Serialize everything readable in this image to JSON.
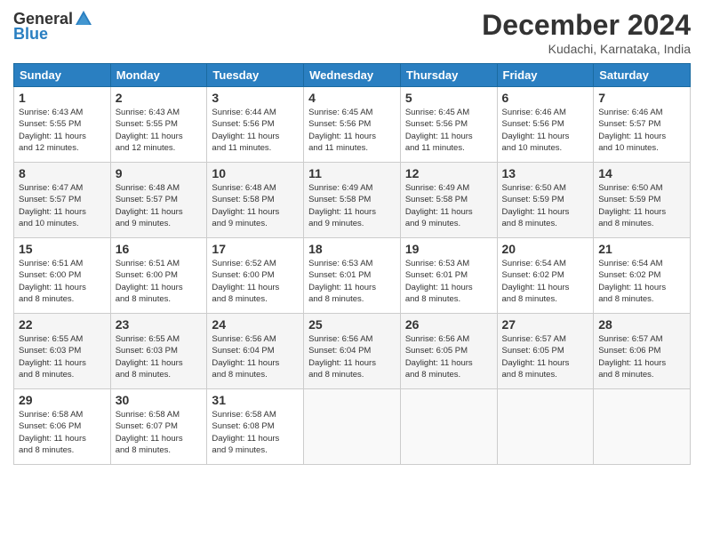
{
  "header": {
    "logo_general": "General",
    "logo_blue": "Blue",
    "title": "December 2024",
    "location": "Kudachi, Karnataka, India"
  },
  "days_of_week": [
    "Sunday",
    "Monday",
    "Tuesday",
    "Wednesday",
    "Thursday",
    "Friday",
    "Saturday"
  ],
  "weeks": [
    [
      {
        "day": "1",
        "info": "Sunrise: 6:43 AM\nSunset: 5:55 PM\nDaylight: 11 hours\nand 12 minutes."
      },
      {
        "day": "2",
        "info": "Sunrise: 6:43 AM\nSunset: 5:55 PM\nDaylight: 11 hours\nand 12 minutes."
      },
      {
        "day": "3",
        "info": "Sunrise: 6:44 AM\nSunset: 5:56 PM\nDaylight: 11 hours\nand 11 minutes."
      },
      {
        "day": "4",
        "info": "Sunrise: 6:45 AM\nSunset: 5:56 PM\nDaylight: 11 hours\nand 11 minutes."
      },
      {
        "day": "5",
        "info": "Sunrise: 6:45 AM\nSunset: 5:56 PM\nDaylight: 11 hours\nand 11 minutes."
      },
      {
        "day": "6",
        "info": "Sunrise: 6:46 AM\nSunset: 5:56 PM\nDaylight: 11 hours\nand 10 minutes."
      },
      {
        "day": "7",
        "info": "Sunrise: 6:46 AM\nSunset: 5:57 PM\nDaylight: 11 hours\nand 10 minutes."
      }
    ],
    [
      {
        "day": "8",
        "info": "Sunrise: 6:47 AM\nSunset: 5:57 PM\nDaylight: 11 hours\nand 10 minutes."
      },
      {
        "day": "9",
        "info": "Sunrise: 6:48 AM\nSunset: 5:57 PM\nDaylight: 11 hours\nand 9 minutes."
      },
      {
        "day": "10",
        "info": "Sunrise: 6:48 AM\nSunset: 5:58 PM\nDaylight: 11 hours\nand 9 minutes."
      },
      {
        "day": "11",
        "info": "Sunrise: 6:49 AM\nSunset: 5:58 PM\nDaylight: 11 hours\nand 9 minutes."
      },
      {
        "day": "12",
        "info": "Sunrise: 6:49 AM\nSunset: 5:58 PM\nDaylight: 11 hours\nand 9 minutes."
      },
      {
        "day": "13",
        "info": "Sunrise: 6:50 AM\nSunset: 5:59 PM\nDaylight: 11 hours\nand 8 minutes."
      },
      {
        "day": "14",
        "info": "Sunrise: 6:50 AM\nSunset: 5:59 PM\nDaylight: 11 hours\nand 8 minutes."
      }
    ],
    [
      {
        "day": "15",
        "info": "Sunrise: 6:51 AM\nSunset: 6:00 PM\nDaylight: 11 hours\nand 8 minutes."
      },
      {
        "day": "16",
        "info": "Sunrise: 6:51 AM\nSunset: 6:00 PM\nDaylight: 11 hours\nand 8 minutes."
      },
      {
        "day": "17",
        "info": "Sunrise: 6:52 AM\nSunset: 6:00 PM\nDaylight: 11 hours\nand 8 minutes."
      },
      {
        "day": "18",
        "info": "Sunrise: 6:53 AM\nSunset: 6:01 PM\nDaylight: 11 hours\nand 8 minutes."
      },
      {
        "day": "19",
        "info": "Sunrise: 6:53 AM\nSunset: 6:01 PM\nDaylight: 11 hours\nand 8 minutes."
      },
      {
        "day": "20",
        "info": "Sunrise: 6:54 AM\nSunset: 6:02 PM\nDaylight: 11 hours\nand 8 minutes."
      },
      {
        "day": "21",
        "info": "Sunrise: 6:54 AM\nSunset: 6:02 PM\nDaylight: 11 hours\nand 8 minutes."
      }
    ],
    [
      {
        "day": "22",
        "info": "Sunrise: 6:55 AM\nSunset: 6:03 PM\nDaylight: 11 hours\nand 8 minutes."
      },
      {
        "day": "23",
        "info": "Sunrise: 6:55 AM\nSunset: 6:03 PM\nDaylight: 11 hours\nand 8 minutes."
      },
      {
        "day": "24",
        "info": "Sunrise: 6:56 AM\nSunset: 6:04 PM\nDaylight: 11 hours\nand 8 minutes."
      },
      {
        "day": "25",
        "info": "Sunrise: 6:56 AM\nSunset: 6:04 PM\nDaylight: 11 hours\nand 8 minutes."
      },
      {
        "day": "26",
        "info": "Sunrise: 6:56 AM\nSunset: 6:05 PM\nDaylight: 11 hours\nand 8 minutes."
      },
      {
        "day": "27",
        "info": "Sunrise: 6:57 AM\nSunset: 6:05 PM\nDaylight: 11 hours\nand 8 minutes."
      },
      {
        "day": "28",
        "info": "Sunrise: 6:57 AM\nSunset: 6:06 PM\nDaylight: 11 hours\nand 8 minutes."
      }
    ],
    [
      {
        "day": "29",
        "info": "Sunrise: 6:58 AM\nSunset: 6:06 PM\nDaylight: 11 hours\nand 8 minutes."
      },
      {
        "day": "30",
        "info": "Sunrise: 6:58 AM\nSunset: 6:07 PM\nDaylight: 11 hours\nand 8 minutes."
      },
      {
        "day": "31",
        "info": "Sunrise: 6:58 AM\nSunset: 6:08 PM\nDaylight: 11 hours\nand 9 minutes."
      },
      {
        "day": "",
        "info": ""
      },
      {
        "day": "",
        "info": ""
      },
      {
        "day": "",
        "info": ""
      },
      {
        "day": "",
        "info": ""
      }
    ]
  ]
}
